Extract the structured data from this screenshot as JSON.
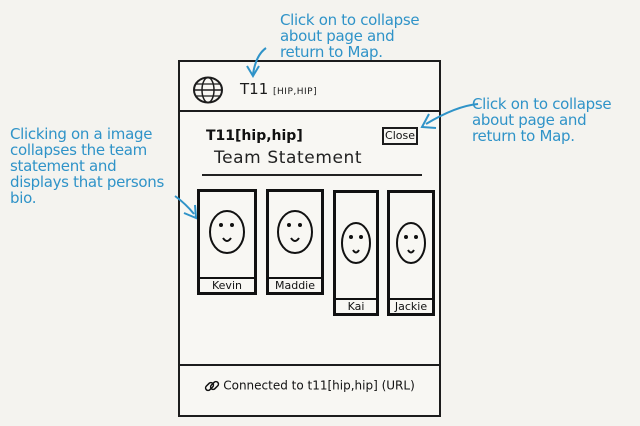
{
  "annotations": {
    "top": "Click on to collapse\nabout page and\nreturn to Map.",
    "right": "Click on to collapse\nabout page and\nreturn to Map.",
    "left": "Clicking on a image\ncollapses the team\nstatement and\ndisplays that persons\nbio."
  },
  "header": {
    "title": "T11",
    "title_suffix": "[HIP,HIP]"
  },
  "about": {
    "title": "T11[hip,hip]",
    "subtitle": "Team Statement",
    "close_label": "Close"
  },
  "members": [
    {
      "name": "Kevin"
    },
    {
      "name": "Maddie"
    },
    {
      "name": "Kai"
    },
    {
      "name": "Jackie"
    }
  ],
  "footer": {
    "text": "Connected to t11[hip,hip] (URL)"
  },
  "colors": {
    "annotation": "#2f93c8",
    "ink": "#1c1c1c",
    "paper": "#f4f3ef"
  }
}
